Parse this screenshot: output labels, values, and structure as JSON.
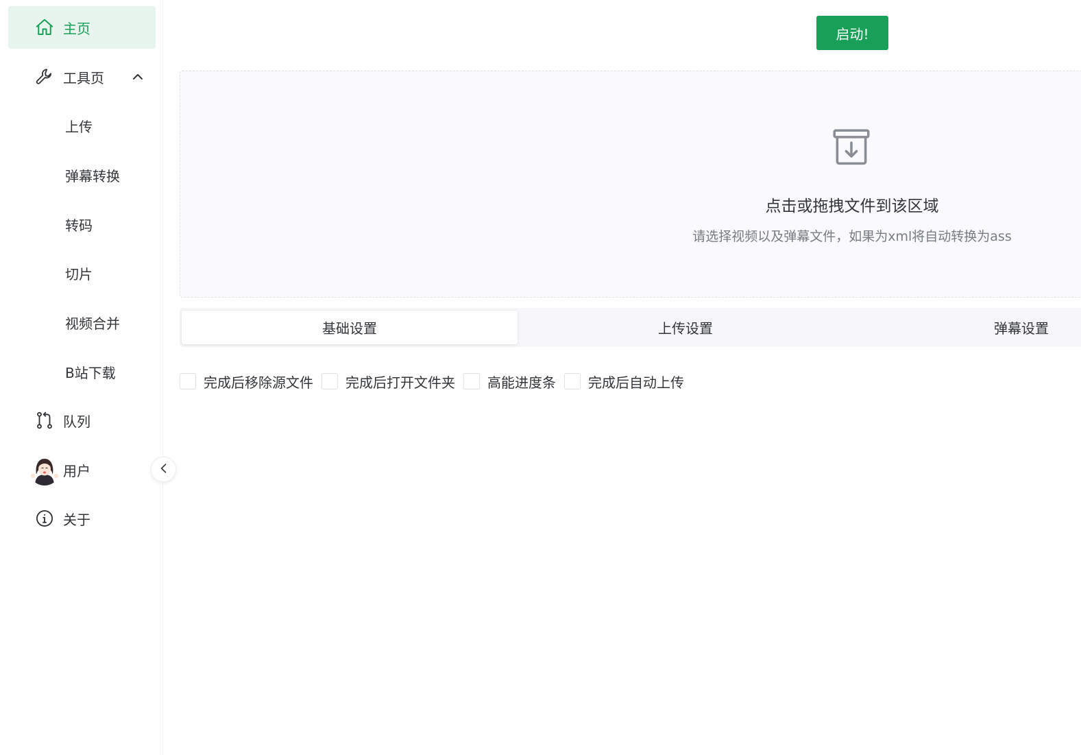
{
  "sidebar": {
    "home": {
      "label": "主页",
      "icon": "home-icon",
      "active": true
    },
    "tools": {
      "label": "工具页",
      "icon": "wrench-icon",
      "expanded": true,
      "items": [
        {
          "label": "上传"
        },
        {
          "label": "弹幕转换"
        },
        {
          "label": "转码"
        },
        {
          "label": "切片"
        },
        {
          "label": "视频合并"
        },
        {
          "label": "B站下载"
        }
      ]
    },
    "queue": {
      "label": "队列",
      "icon": "git-pull-request-icon"
    },
    "user": {
      "label": "用户",
      "icon": "avatar"
    },
    "about": {
      "label": "关于",
      "icon": "info-icon"
    }
  },
  "main": {
    "start_label": "启动!",
    "dropzone": {
      "title": "点击或拖拽文件到该区域",
      "hint": "请选择视频以及弹幕文件，如果为xml将自动转换为ass"
    },
    "tabs": [
      {
        "label": "基础设置",
        "active": true
      },
      {
        "label": "上传设置",
        "active": false
      },
      {
        "label": "弹幕设置",
        "active": false
      }
    ],
    "options": [
      {
        "label": "完成后移除源文件",
        "checked": false
      },
      {
        "label": "完成后打开文件夹",
        "checked": false
      },
      {
        "label": "高能进度条",
        "checked": false
      },
      {
        "label": "完成后自动上传",
        "checked": false
      }
    ]
  },
  "colors": {
    "accent": "#18a058",
    "active_bg": "#e7f5ee",
    "text": "#333639",
    "muted": "#767c82",
    "border": "#e0e0e6"
  }
}
